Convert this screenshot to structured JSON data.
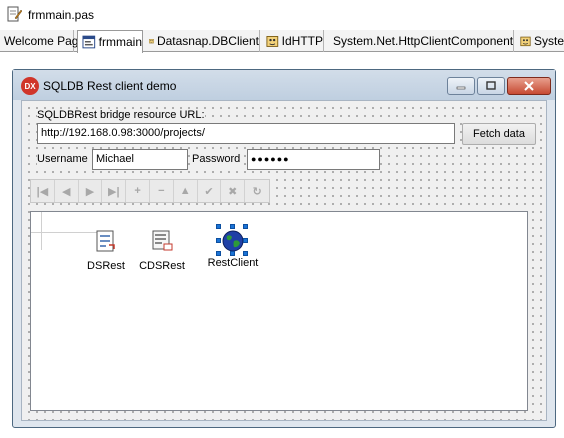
{
  "window": {
    "title": "frmmain.pas"
  },
  "tabs": [
    {
      "label": "Welcome Page",
      "icon": "none"
    },
    {
      "label": "frmmain",
      "icon": "form-icon",
      "active": true
    },
    {
      "label": "Datasnap.DBClient",
      "icon": "unit-icon"
    },
    {
      "label": "IdHTTP",
      "icon": "unit-icon"
    },
    {
      "label": "System.Net.HttpClientComponent",
      "icon": "unit-icon"
    },
    {
      "label": "Syste",
      "icon": "unit-icon"
    }
  ],
  "form": {
    "title": "SQLDB Rest client demo",
    "icon_text": "DX",
    "url_label": "SQLDBRest bridge resource URL:",
    "url_value": "http://192.168.0.98:3000/projects/",
    "fetch_button": "Fetch data",
    "username_label": "Username",
    "username_value": "Michael",
    "password_label": "Password",
    "password_value": "●●●●●●"
  },
  "navigator": {
    "buttons": [
      "first",
      "prior",
      "next",
      "last",
      "insert",
      "delete",
      "edit",
      "post",
      "cancel",
      "refresh"
    ],
    "glyphs": [
      "|◀",
      "◀",
      "▶",
      "▶|",
      "+",
      "−",
      "▲",
      "✔",
      "✖",
      "↻"
    ]
  },
  "components": [
    {
      "label": "DSRest",
      "icon": "datasource-icon"
    },
    {
      "label": "CDSRest",
      "icon": "clientdataset-icon"
    },
    {
      "label": "RestClient",
      "icon": "globe-icon",
      "selected": true
    }
  ],
  "colors": {
    "selection_handle": "#1a73d6",
    "form_caption": "#c8d6e6",
    "close_button": "#c74a33"
  }
}
